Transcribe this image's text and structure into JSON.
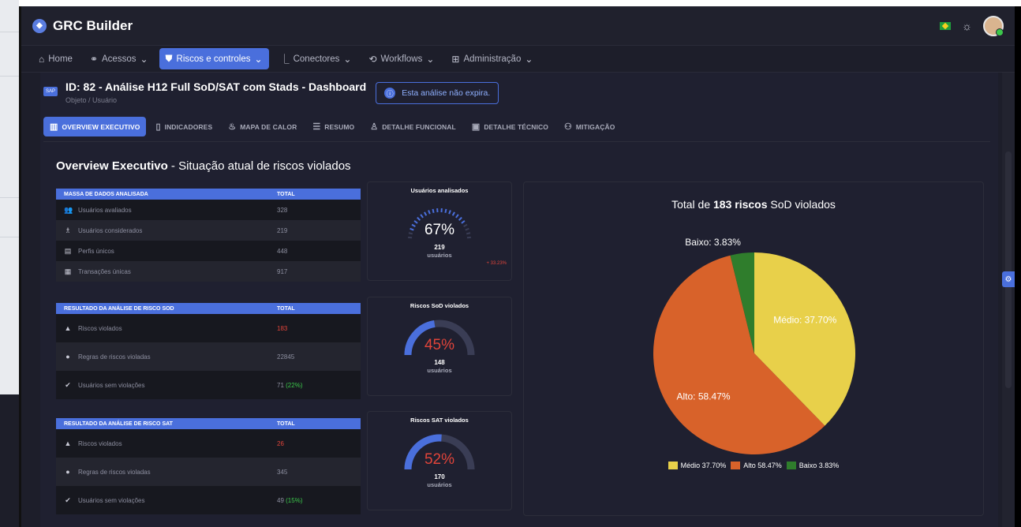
{
  "app": {
    "brand": "GRC Builder"
  },
  "nav": [
    {
      "label": "Home",
      "icon": "home-icon",
      "glyph": "⌂",
      "active": false,
      "chevron": false
    },
    {
      "label": "Acessos",
      "icon": "network-icon",
      "glyph": "⚭",
      "active": false,
      "chevron": true
    },
    {
      "label": "Riscos e controles",
      "icon": "shield-icon",
      "glyph": "⛊",
      "active": true,
      "chevron": true
    },
    {
      "label": "Conectores",
      "icon": "connector-icon",
      "glyph": "⎿",
      "active": false,
      "chevron": true
    },
    {
      "label": "Workflows",
      "icon": "workflow-icon",
      "glyph": "⟲",
      "active": false,
      "chevron": true
    },
    {
      "label": "Administração",
      "icon": "grid-icon",
      "glyph": "⊞",
      "active": false,
      "chevron": true
    }
  ],
  "header": {
    "title": "ID: 82 - Análise H12 Full SoD/SAT com Stads - Dashboard",
    "subtitle": "Objeto / Usuário",
    "expiry": "Esta análise não expira."
  },
  "tabs": [
    {
      "label": "OVERVIEW EXECUTIVO",
      "icon": "chart-icon",
      "glyph": "▥",
      "active": true
    },
    {
      "label": "INDICADORES",
      "icon": "indicator-icon",
      "glyph": "▯",
      "active": false
    },
    {
      "label": "MAPA DE CALOR",
      "icon": "fire-icon",
      "glyph": "♨",
      "active": false
    },
    {
      "label": "RESUMO",
      "icon": "list-icon",
      "glyph": "☰",
      "active": false
    },
    {
      "label": "DETALHE FUNCIONAL",
      "icon": "user-list-icon",
      "glyph": "♙",
      "active": false
    },
    {
      "label": "DETALHE TÉCNICO",
      "icon": "terminal-icon",
      "glyph": "▣",
      "active": false
    },
    {
      "label": "MITIGAÇÃO",
      "icon": "users-icon",
      "glyph": "⚇",
      "active": false
    }
  ],
  "overview": {
    "title_bold": "Overview Executivo",
    "title_rest": " - Situação atual de riscos violados"
  },
  "tables": [
    {
      "header": "MASSA DE DADOS ANALISADA",
      "total_label": "TOTAL",
      "row_height": "normal",
      "rows": [
        {
          "icon": "users-icon",
          "glyph": "👥",
          "label": "Usuários avaliados",
          "value": "328",
          "value_color": "",
          "extra": ""
        },
        {
          "icon": "user-check-icon",
          "glyph": "♗",
          "label": "Usuários considerados",
          "value": "219",
          "value_color": "",
          "extra": ""
        },
        {
          "icon": "profile-icon",
          "glyph": "▤",
          "label": "Perfis únicos",
          "value": "448",
          "value_color": "",
          "extra": ""
        },
        {
          "icon": "transaction-icon",
          "glyph": "▦",
          "label": "Transações únicas",
          "value": "917",
          "value_color": "",
          "extra": ""
        }
      ]
    },
    {
      "header": "RESULTADO DA ANÁLISE DE RISCO SOD",
      "total_label": "TOTAL",
      "row_height": "tall",
      "rows": [
        {
          "icon": "warning-icon",
          "glyph": "▲",
          "label": "Riscos violados",
          "value": "183",
          "value_color": "red",
          "extra": ""
        },
        {
          "icon": "alert-circle-icon",
          "glyph": "●",
          "label": "Regras de riscos violadas",
          "value": "22845",
          "value_color": "",
          "extra": ""
        },
        {
          "icon": "check-circle-icon",
          "glyph": "✔",
          "label": "Usuários sem violações",
          "value": "71",
          "value_color": "",
          "extra": "(22%)"
        }
      ]
    },
    {
      "header": "RESULTADO DA ANÁLISE DE RISCO SAT",
      "total_label": "TOTAL",
      "row_height": "tall",
      "rows": [
        {
          "icon": "warning-icon",
          "glyph": "▲",
          "label": "Riscos violados",
          "value": "26",
          "value_color": "red",
          "extra": ""
        },
        {
          "icon": "alert-circle-icon",
          "glyph": "●",
          "label": "Regras de riscos violadas",
          "value": "345",
          "value_color": "",
          "extra": ""
        },
        {
          "icon": "check-circle-icon",
          "glyph": "✔",
          "label": "Usuários sem violações",
          "value": "49",
          "value_color": "",
          "extra": "(15%)"
        }
      ]
    }
  ],
  "gauges": [
    {
      "title": "Usuários analisados",
      "percent": 67,
      "percent_text": "67%",
      "count": "219",
      "unit": "usuários",
      "delta": "+ 33.23%",
      "style": "ticks",
      "color": "#ffffff"
    },
    {
      "title": "Riscos SoD violados",
      "percent": 45,
      "percent_text": "45%",
      "count": "148",
      "unit": "usuários",
      "delta": "",
      "style": "arc",
      "color": "#e0443a"
    },
    {
      "title": "Riscos SAT violados",
      "percent": 52,
      "percent_text": "52%",
      "count": "170",
      "unit": "usuários",
      "delta": "",
      "style": "arc",
      "color": "#e0443a"
    }
  ],
  "chart_data": {
    "type": "pie",
    "title_prefix": "Total de ",
    "title_bold": "183 riscos",
    "title_suffix": " SoD violados",
    "series": [
      {
        "name": "Médio",
        "value": 37.7,
        "label": "Médio: 37.70%",
        "legend": "Médio 37.70%",
        "color": "#e8d04a"
      },
      {
        "name": "Alto",
        "value": 58.47,
        "label": "Alto: 58.47%",
        "legend": "Alto 58.47%",
        "color": "#d8622a"
      },
      {
        "name": "Baixo",
        "value": 3.83,
        "label": "Baixo: 3.83%",
        "legend": "Baixo 3.83%",
        "color": "#2f7d2c"
      }
    ],
    "legend_position": "bottom"
  }
}
